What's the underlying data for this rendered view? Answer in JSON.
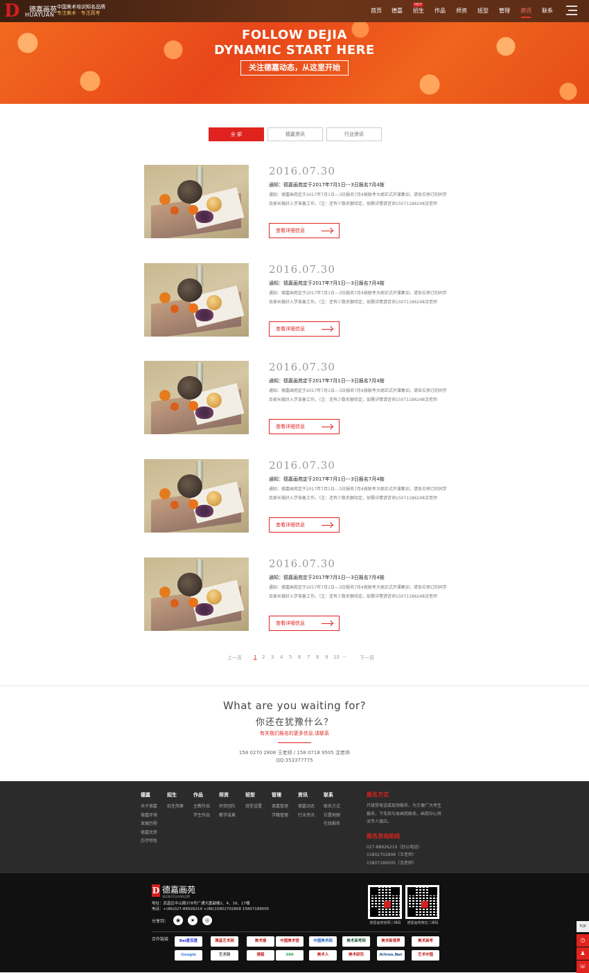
{
  "header": {
    "logo_mark": "D",
    "logo_cn": "德嘉画苑",
    "logo_en": "HUAYUAN",
    "slogan_line1": "中国美术培训知名品牌",
    "slogan_line2": "专注美术 · 专注高考",
    "nav": [
      "首页",
      "德嘉",
      "招生",
      "作品",
      "师资",
      "班型",
      "管理",
      "资讯",
      "联系"
    ],
    "active_nav": "资讯",
    "hot_badge": "HOT"
  },
  "banner": {
    "line1": "FOLLOW DEJIA",
    "line2": "DYNAMIC START HERE",
    "tagline": "关注德嘉动态，从这里开始"
  },
  "tabs": [
    "全 部",
    "德嘉资讯",
    "行业资讯"
  ],
  "articles": [
    {
      "date": "2016.07.30",
      "title": "通知：德嘉画苑定于2017年7月1日---3日报名7月4按",
      "desc": "通知：德嘉画苑定于2017年7月1日---3日报名7月4按联考大纲正式开课集训，请各位预订的同学及家长做好入学准备工作。（注：还有少数名额待定，如需详情请咨询15071186248沈老师",
      "button": "查看详细信息"
    },
    {
      "date": "2016.07.30",
      "title": "通知：德嘉画苑定于2017年7月1日---3日报名7月4按",
      "desc": "通知：德嘉画苑定于2017年7月1日---3日报名7月4按联考大纲正式开课集训，请各位预订的同学及家长做好入学准备工作。（注：还有少数名额待定，如需详情请咨询15071186248沈老师",
      "button": "查看详细信息"
    },
    {
      "date": "2016.07.30",
      "title": "通知：德嘉画苑定于2017年7月1日---3日报名7月4按",
      "desc": "通知：德嘉画苑定于2017年7月1日---3日报名7月4按联考大纲正式开课集训，请各位预订的同学及家长做好入学准备工作。（注：还有少数名额待定，如需详情请咨询15071186248沈老师",
      "button": "查看详细信息"
    },
    {
      "date": "2016.07.30",
      "title": "通知：德嘉画苑定于2017年7月1日---3日报名7月4按",
      "desc": "通知：德嘉画苑定于2017年7月1日---3日报名7月4按联考大纲正式开课集训，请各位预订的同学及家长做好入学准备工作。（注：还有少数名额待定，如需详情请咨询15071186248沈老师",
      "button": "查看详细信息"
    },
    {
      "date": "2016.07.30",
      "title": "通知：德嘉画苑定于2017年7月1日---3日报名7月4按",
      "desc": "通知：德嘉画苑定于2017年7月1日---3日报名7月4按联考大纲正式开课集训，请各位预订的同学及家长做好入学准备工作。（注：还有少数名额待定，如需详情请咨询15071186248沈老师",
      "button": "查看详细信息"
    }
  ],
  "pagination": {
    "prev": "上一页",
    "pages": [
      "1",
      "2",
      "3",
      "4",
      "5",
      "6",
      "7",
      "8",
      "9",
      "10"
    ],
    "current": "1",
    "ellipsis": "···",
    "next": "下一页"
  },
  "cta": {
    "en": "What are you waiting for?",
    "cn": "你还在犹豫什么？",
    "sub": "有关我们报名的更多信息,请联系",
    "phones": "158 0270 2808 王老师 / 158 0718 9505 沈老师",
    "qq": "QQ:353377775"
  },
  "footer_cols": [
    {
      "title": "德嘉",
      "links": [
        "关于德嘉",
        "德嘉环境",
        "发展历程",
        "德嘉优势",
        "办学特色"
      ]
    },
    {
      "title": "招生",
      "links": [
        "招生简章"
      ]
    },
    {
      "title": "作品",
      "links": [
        "主教作品",
        "学生作品"
      ]
    },
    {
      "title": "师资",
      "links": [
        "师资团队",
        "教学成果"
      ]
    },
    {
      "title": "班型",
      "links": [
        "班型设置"
      ]
    },
    {
      "title": "管理",
      "links": [
        "德嘉管理",
        "学籍管理"
      ]
    },
    {
      "title": "资讯",
      "links": [
        "德嘉动态",
        "行业资讯"
      ]
    },
    {
      "title": "联系",
      "links": [
        "联系方式",
        "位置地图",
        "在线报名"
      ]
    }
  ],
  "footer_contact": {
    "method_title": "报名方式",
    "method_text": "只接受电话或现场报名，为方便广大考生报名，下车后与本画苑联系，画苑中心将派专人接应。",
    "hotline_title": "报名咨询热线",
    "hotlines": [
      "027-88926219（办公电话）",
      "15802702808（王老师）",
      "15807189505（沈老师）"
    ]
  },
  "footer_bottom": {
    "logo_mark": "D",
    "logo_name": "德嘉画苑",
    "logo_sub": "湖北美术培训机构品牌",
    "address": "地址：武昌区中山路378号广通大厦副楼2、4、16、17楼",
    "phone": "电话：+(86)027-88926219 +(86)15802702808 15807189505",
    "share_label": "分享到：",
    "share_icons": [
      "weixin-icon",
      "qzone-icon",
      "weibo-icon"
    ],
    "qr_captions": [
      "德嘉画苑官网二维码",
      "德嘉画苑微信二维码"
    ],
    "links_label": "合作链接",
    "partner_links": [
      "Bai度百度",
      "雅昌艺术网",
      "美术报",
      "中国美术馆",
      "中国美术网",
      "美术高考网",
      "美术新视界",
      "美术高考",
      "Google",
      "艺术网",
      "搜狐",
      "360",
      "美术人",
      "美术研究",
      "Artron.Net",
      "艺术中国"
    ],
    "partner_colors": [
      "#2932e1",
      "#c0201e",
      "#c0201e",
      "#c0201e",
      "#2a6ac8",
      "#1b5c3a",
      "#c0201e",
      "#c0201e",
      "#3b7ae0",
      "#555555",
      "#c0201e",
      "#2aa34a",
      "#c0201e",
      "#c0201e",
      "#1a4a8a",
      "#c0201e"
    ]
  },
  "side": {
    "top": "TOP"
  },
  "colors": {
    "accent": "#e0231e",
    "footer_dark": "#2b2b2b",
    "footer_darker": "#111111"
  }
}
